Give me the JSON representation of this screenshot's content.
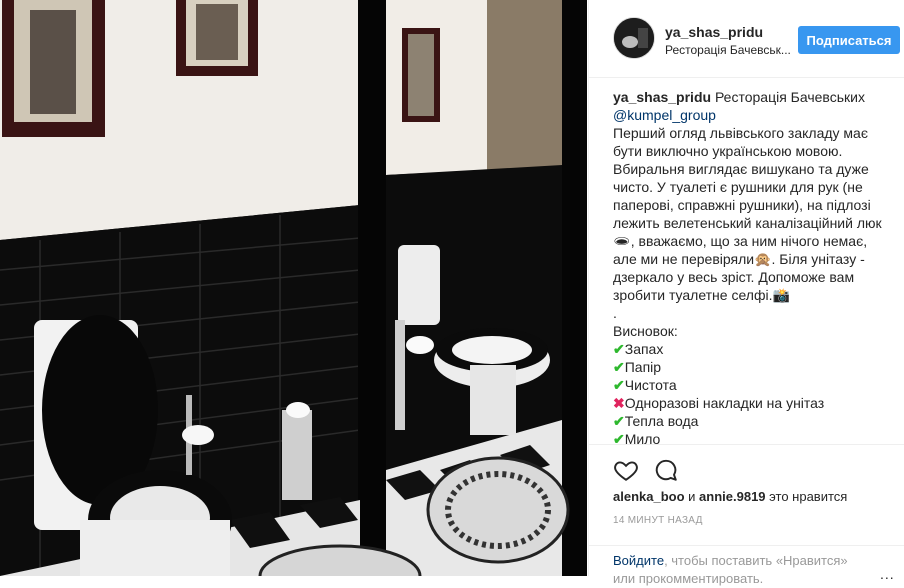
{
  "post": {
    "username": "ya_shas_pridu",
    "location": "Ресторація Бачевськ...",
    "follow_label": "Подписаться",
    "caption": {
      "username": "ya_shas_pridu",
      "first_line": "Ресторація Бачевських",
      "mention": "@kumpel_group",
      "lines": [
        "Перший огляд львівського закладу має",
        "бути виключно українською мовою.",
        "Вбиральня виглядає вишукано та дуже",
        "чисто. У туалеті є рушники для рук (не",
        "паперові, справжні рушники), на підлозі",
        "лежить велетенський каналізаційний люк",
        "🕳, вважаємо, що за ним нічого немає,",
        "але ми не перевіряли🙊. Біля унітазу -",
        "дзеркало у весь зріст. Допоможе вам",
        "зробити туалетне селфі.📸",
        ".",
        "Висновок:"
      ],
      "checklist": [
        {
          "mark": "✔",
          "status": "ok",
          "text": "Запах"
        },
        {
          "mark": "✔",
          "status": "ok",
          "text": "Папір"
        },
        {
          "mark": "✔",
          "status": "ok",
          "text": "Чистота"
        },
        {
          "mark": "✖",
          "status": "bad",
          "text": "Одноразові накладки на унітаз"
        },
        {
          "mark": "✔",
          "status": "ok",
          "text": "Тепла вода"
        },
        {
          "mark": "✔",
          "status": "ok",
          "text": "Мило"
        }
      ]
    },
    "likes": {
      "user1": "alenka_boo",
      "and": "и",
      "user2": "annie.9819",
      "suffix": "это нравится"
    },
    "timestamp": "14 МИНУТ НАЗАД",
    "login_prompt": {
      "link": "Войдите",
      "text": ", чтобы поставить «Нравится»",
      "text2": "или прокомментировать."
    },
    "more": "..."
  },
  "icons": {
    "like": "heart-icon",
    "comment": "comment-icon",
    "more": "more-options-icon"
  },
  "colors": {
    "follow_button": "#3897f0",
    "link": "#003569",
    "muted": "#999999",
    "check": "#2eb82e",
    "cross": "#e0245e"
  }
}
